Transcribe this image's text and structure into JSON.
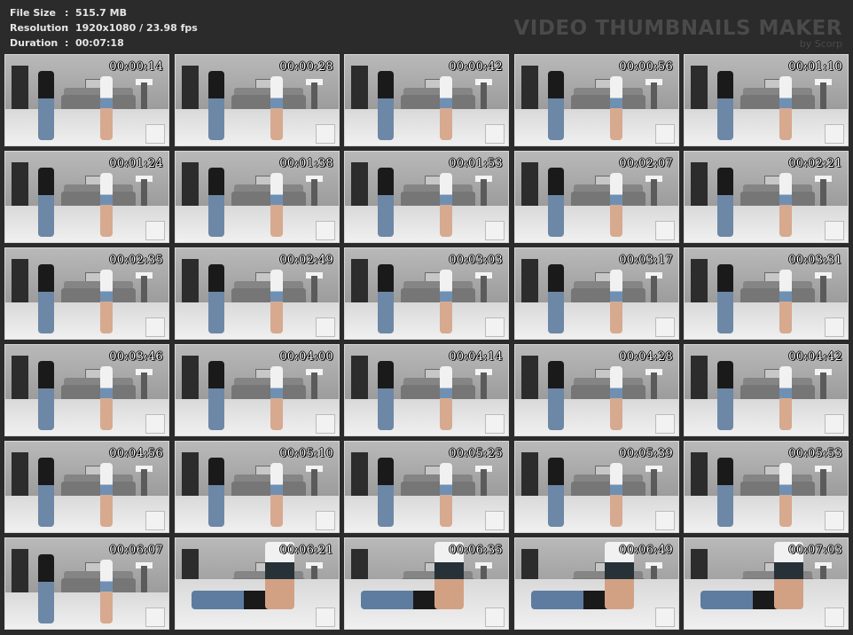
{
  "header": {
    "file_size_label": "File Size",
    "file_size_value": "515.7 MB",
    "resolution_label": "Resolution",
    "resolution_value": "1920x1080 / 23.98 fps",
    "duration_label": "Duration",
    "duration_value": "00:07:18",
    "colon": ":"
  },
  "brand": {
    "title": "VIDEO THUMBNAILS MAKER",
    "subtitle": "by Scorp"
  },
  "thumbnails": [
    "00:00:14",
    "00:00:28",
    "00:00:42",
    "00:00:56",
    "00:01:10",
    "00:01:24",
    "00:01:38",
    "00:01:53",
    "00:02:07",
    "00:02:21",
    "00:02:35",
    "00:02:49",
    "00:03:03",
    "00:03:17",
    "00:03:31",
    "00:03:46",
    "00:04:00",
    "00:04:14",
    "00:04:28",
    "00:04:42",
    "00:04:56",
    "00:05:10",
    "00:05:25",
    "00:05:39",
    "00:05:53",
    "00:06:07",
    "00:06:21",
    "00:06:35",
    "00:06:49",
    "00:07:03"
  ]
}
